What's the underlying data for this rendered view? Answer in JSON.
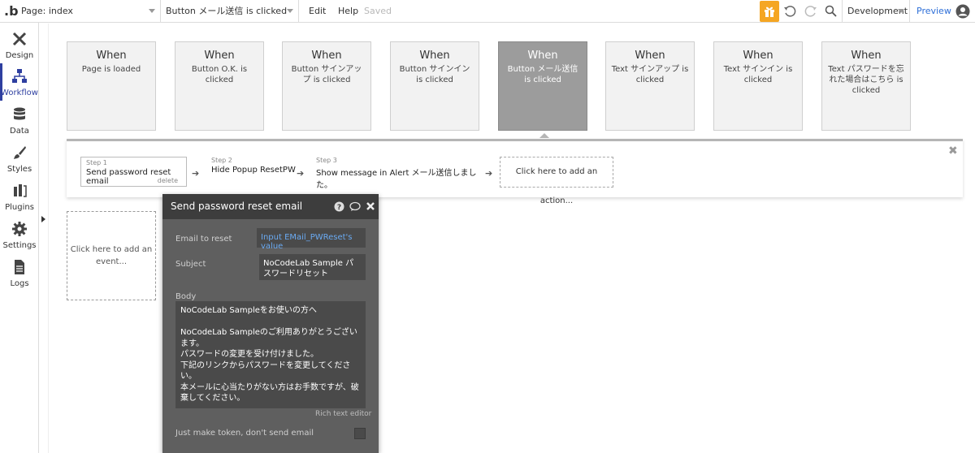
{
  "topbar": {
    "logo": ".b",
    "page_select": "Page: index",
    "element_select": "Button メール送信 is clicked",
    "edit": "Edit",
    "help": "Help",
    "saved": "Saved",
    "env_select": "Development",
    "preview": "Preview"
  },
  "sidebar": {
    "items": [
      {
        "label": "Design",
        "icon": "design-icon"
      },
      {
        "label": "Workflow",
        "icon": "workflow-icon"
      },
      {
        "label": "Data",
        "icon": "database-icon"
      },
      {
        "label": "Styles",
        "icon": "brush-icon"
      },
      {
        "label": "Plugins",
        "icon": "plug-icon"
      },
      {
        "label": "Settings",
        "icon": "gear-icon"
      },
      {
        "label": "Logs",
        "icon": "document-icon"
      }
    ]
  },
  "events": [
    {
      "when": "When",
      "desc": "Page is loaded"
    },
    {
      "when": "When",
      "desc": "Button O.K. is clicked"
    },
    {
      "when": "When",
      "desc": "Button サインアップ is clicked"
    },
    {
      "when": "When",
      "desc": "Button サインイン is clicked"
    },
    {
      "when": "When",
      "desc": "Button メール送信 is clicked"
    },
    {
      "when": "When",
      "desc": "Text サインアップ is clicked"
    },
    {
      "when": "When",
      "desc": "Text サインイン is clicked"
    },
    {
      "when": "When",
      "desc": "Text パスワードを忘れた場合はこちら is clicked"
    }
  ],
  "actions": {
    "steps": [
      {
        "num": "Step 1",
        "name": "Send password reset email",
        "delete": "delete"
      },
      {
        "num": "Step 2",
        "name": "Hide Popup ResetPW"
      },
      {
        "num": "Step 3",
        "name": "Show message in Alert メール送信しました。"
      }
    ],
    "add_action": "Click here to add an action...",
    "arrow": "➔",
    "close": "✖"
  },
  "add_event": "Click here to add an event...",
  "panel": {
    "title": "Send password reset email",
    "email_label": "Email to reset",
    "email_value": "Input EMail_PWReset's value",
    "subject_label": "Subject",
    "subject_value": "NoCodeLab Sample パスワードリセット",
    "body_label": "Body",
    "body_value": "NoCodeLab Sampleをお使いの方へ\n\nNoCodeLab Sampleのご利用ありがとうございます。\nパスワードの変更を受け付けました。\n下記のリンクからパスワードを変更してください。\n本メールに心当たりがない方はお手数ですが、破棄してください。",
    "rich_text": "Rich text editor",
    "token_label": "Just make token, don't send email"
  },
  "colors": {
    "accent": "#2e3fa0",
    "gift": "#f5a623",
    "preview_link": "#2e6fd8",
    "selected_event": "#9c9c9c",
    "panel_bg": "#5f5f5f"
  }
}
